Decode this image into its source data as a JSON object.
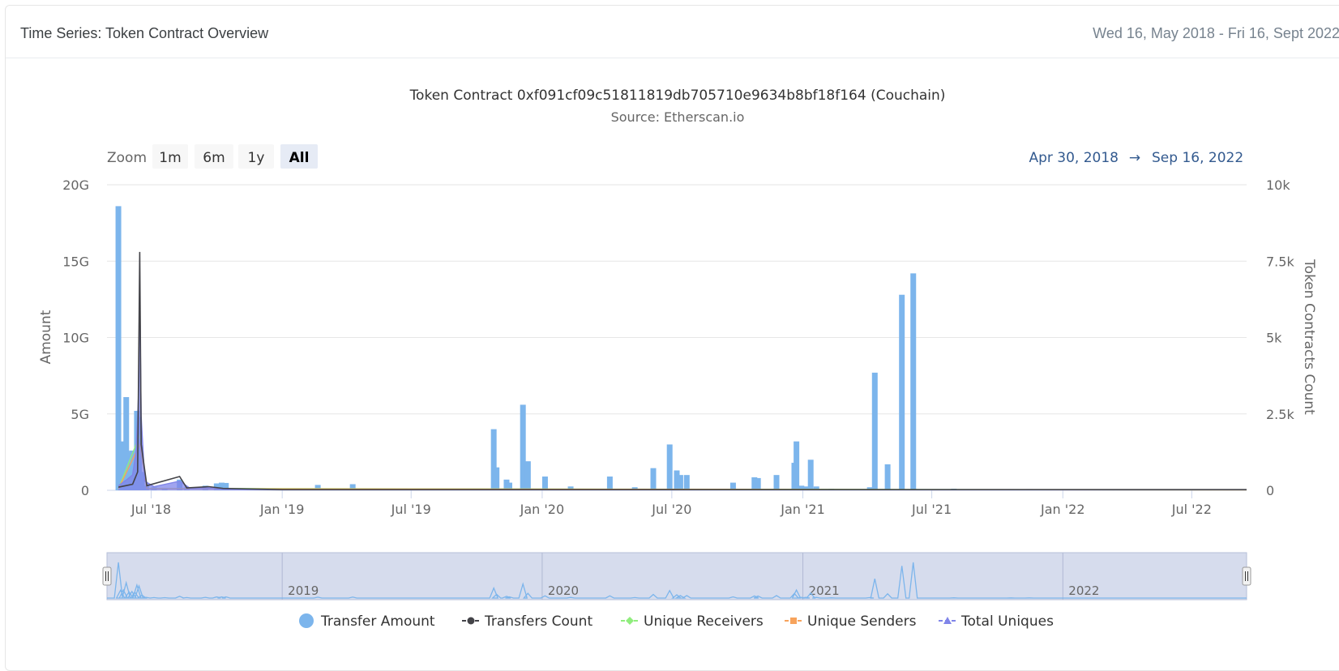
{
  "header": {
    "title": "Time Series: Token Contract Overview",
    "range": "Wed 16, May 2018 - Fri 16, Sept 2022"
  },
  "zoom": {
    "label": "Zoom",
    "buttons": [
      "1m",
      "6m",
      "1y",
      "All"
    ],
    "active": "All"
  },
  "range_display": {
    "from": "Apr 30, 2018",
    "arrow": "→",
    "to": "Sep 16, 2022"
  },
  "navigator": {
    "year_labels": [
      "2019",
      "2020",
      "2021",
      "2022"
    ]
  },
  "colors": {
    "transfer_amount": "#7cb5ec",
    "transfers_count": "#434348",
    "unique_receivers": "#90ed7d",
    "unique_senders": "#f7a35c",
    "total_uniques": "#8085e9",
    "range_text": "#335a8f",
    "navigator_mask": "#cfd6ea"
  },
  "chart_data": {
    "type": "bar",
    "title": "Token Contract 0xf091cf09c51811819db705710e9634b8bf18f164 (Couchain)",
    "subtitle": "Source: Etherscan.io",
    "xlabel": "",
    "ylabel": "Amount",
    "y2label": "Token Contracts Count",
    "xlim": [
      "2018-04-30",
      "2022-09-16"
    ],
    "ylim": [
      0,
      20000000000
    ],
    "y2lim": [
      0,
      10000
    ],
    "yticks": [
      "0",
      "5G",
      "10G",
      "15G",
      "20G"
    ],
    "y2ticks": [
      "0",
      "2.5k",
      "5k",
      "7.5k",
      "10k"
    ],
    "xticks": [
      {
        "date": "2018-07-01",
        "label": "Jul '18"
      },
      {
        "date": "2019-01-01",
        "label": "Jan '19"
      },
      {
        "date": "2019-07-01",
        "label": "Jul '19"
      },
      {
        "date": "2020-01-01",
        "label": "Jan '20"
      },
      {
        "date": "2020-07-01",
        "label": "Jul '20"
      },
      {
        "date": "2021-01-01",
        "label": "Jan '21"
      },
      {
        "date": "2021-07-01",
        "label": "Jul '21"
      },
      {
        "date": "2022-01-01",
        "label": "Jan '22"
      },
      {
        "date": "2022-07-01",
        "label": "Jul '22"
      }
    ],
    "grid": true,
    "legend_position": "bottom",
    "legend": [
      {
        "name": "Transfer Amount",
        "symbol": "circle"
      },
      {
        "name": "Transfers Count",
        "symbol": "line-circle"
      },
      {
        "name": "Unique Receivers",
        "symbol": "line-diamond"
      },
      {
        "name": "Unique Senders",
        "symbol": "line-square"
      },
      {
        "name": "Total Uniques",
        "symbol": "line-triangle"
      }
    ],
    "series": [
      {
        "name": "Transfer Amount",
        "axis": "left",
        "type": "column",
        "points": [
          {
            "x": "2018-05-16",
            "y": 18600000000
          },
          {
            "x": "2018-05-19",
            "y": 3100000000
          },
          {
            "x": "2018-05-23",
            "y": 3200000000
          },
          {
            "x": "2018-05-27",
            "y": 6100000000
          },
          {
            "x": "2018-05-31",
            "y": 2500000000
          },
          {
            "x": "2018-06-04",
            "y": 2600000000
          },
          {
            "x": "2018-06-08",
            "y": 2400000000
          },
          {
            "x": "2018-06-11",
            "y": 5200000000
          },
          {
            "x": "2018-06-14",
            "y": 4800000000
          },
          {
            "x": "2018-06-18",
            "y": 1200000000
          },
          {
            "x": "2018-06-24",
            "y": 300000000
          },
          {
            "x": "2018-07-05",
            "y": 200000000
          },
          {
            "x": "2018-07-20",
            "y": 150000000
          },
          {
            "x": "2018-08-10",
            "y": 700000000
          },
          {
            "x": "2018-08-20",
            "y": 200000000
          },
          {
            "x": "2018-09-15",
            "y": 300000000
          },
          {
            "x": "2018-10-01",
            "y": 450000000
          },
          {
            "x": "2018-10-08",
            "y": 500000000
          },
          {
            "x": "2018-10-14",
            "y": 480000000
          },
          {
            "x": "2019-02-20",
            "y": 350000000
          },
          {
            "x": "2019-04-10",
            "y": 400000000
          },
          {
            "x": "2019-10-25",
            "y": 4000000000
          },
          {
            "x": "2019-10-29",
            "y": 1500000000
          },
          {
            "x": "2019-11-12",
            "y": 700000000
          },
          {
            "x": "2019-11-16",
            "y": 500000000
          },
          {
            "x": "2019-12-05",
            "y": 5600000000
          },
          {
            "x": "2019-12-12",
            "y": 1900000000
          },
          {
            "x": "2020-01-05",
            "y": 900000000
          },
          {
            "x": "2020-02-10",
            "y": 250000000
          },
          {
            "x": "2020-04-05",
            "y": 900000000
          },
          {
            "x": "2020-05-10",
            "y": 200000000
          },
          {
            "x": "2020-06-05",
            "y": 1450000000
          },
          {
            "x": "2020-06-28",
            "y": 3000000000
          },
          {
            "x": "2020-07-08",
            "y": 1300000000
          },
          {
            "x": "2020-07-13",
            "y": 1000000000
          },
          {
            "x": "2020-07-22",
            "y": 1000000000
          },
          {
            "x": "2020-09-25",
            "y": 500000000
          },
          {
            "x": "2020-10-25",
            "y": 850000000
          },
          {
            "x": "2020-10-30",
            "y": 800000000
          },
          {
            "x": "2020-11-25",
            "y": 1000000000
          },
          {
            "x": "2020-12-20",
            "y": 1800000000
          },
          {
            "x": "2020-12-23",
            "y": 3200000000
          },
          {
            "x": "2020-12-30",
            "y": 300000000
          },
          {
            "x": "2021-01-05",
            "y": 250000000
          },
          {
            "x": "2021-01-12",
            "y": 2000000000
          },
          {
            "x": "2021-01-20",
            "y": 250000000
          },
          {
            "x": "2021-02-10",
            "y": 100000000
          },
          {
            "x": "2021-04-05",
            "y": 200000000
          },
          {
            "x": "2021-04-12",
            "y": 7700000000
          },
          {
            "x": "2021-04-30",
            "y": 1700000000
          },
          {
            "x": "2021-05-20",
            "y": 12800000000
          },
          {
            "x": "2021-06-05",
            "y": 14200000000
          },
          {
            "x": "2021-08-01",
            "y": 100000000
          },
          {
            "x": "2021-10-20",
            "y": 80000000
          },
          {
            "x": "2021-11-15",
            "y": 80000000
          }
        ]
      },
      {
        "name": "Transfers Count",
        "axis": "right",
        "type": "line",
        "points": [
          {
            "x": "2018-05-16",
            "y": 100
          },
          {
            "x": "2018-06-05",
            "y": 200
          },
          {
            "x": "2018-06-12",
            "y": 600
          },
          {
            "x": "2018-06-15",
            "y": 7800
          },
          {
            "x": "2018-06-17",
            "y": 1500
          },
          {
            "x": "2018-06-25",
            "y": 150
          },
          {
            "x": "2018-08-10",
            "y": 450
          },
          {
            "x": "2018-08-20",
            "y": 80
          },
          {
            "x": "2018-09-20",
            "y": 120
          },
          {
            "x": "2018-10-10",
            "y": 60
          },
          {
            "x": "2019-01-01",
            "y": 20
          },
          {
            "x": "2022-09-16",
            "y": 20
          }
        ]
      },
      {
        "name": "Unique Receivers",
        "axis": "right",
        "type": "line",
        "points": [
          {
            "x": "2018-05-16",
            "y": 50
          },
          {
            "x": "2018-06-15",
            "y": 1800
          },
          {
            "x": "2018-06-25",
            "y": 60
          },
          {
            "x": "2022-09-16",
            "y": 10
          }
        ]
      },
      {
        "name": "Unique Senders",
        "axis": "right",
        "type": "line",
        "points": [
          {
            "x": "2018-05-16",
            "y": 40
          },
          {
            "x": "2018-06-15",
            "y": 1500
          },
          {
            "x": "2018-06-25",
            "y": 50
          },
          {
            "x": "2022-09-16",
            "y": 10
          }
        ]
      },
      {
        "name": "Total Uniques",
        "axis": "right",
        "type": "area",
        "points": [
          {
            "x": "2018-05-16",
            "y": 150
          },
          {
            "x": "2018-05-28",
            "y": 350
          },
          {
            "x": "2018-06-05",
            "y": 500
          },
          {
            "x": "2018-06-10",
            "y": 1300
          },
          {
            "x": "2018-06-13",
            "y": 3000
          },
          {
            "x": "2018-06-15",
            "y": 6400
          },
          {
            "x": "2018-06-17",
            "y": 2400
          },
          {
            "x": "2018-06-22",
            "y": 300
          },
          {
            "x": "2018-07-05",
            "y": 120
          },
          {
            "x": "2018-08-10",
            "y": 300
          },
          {
            "x": "2018-08-25",
            "y": 60
          },
          {
            "x": "2018-09-20",
            "y": 80
          },
          {
            "x": "2018-10-20",
            "y": 30
          },
          {
            "x": "2019-01-01",
            "y": 15
          },
          {
            "x": "2022-09-16",
            "y": 15
          }
        ]
      }
    ]
  }
}
